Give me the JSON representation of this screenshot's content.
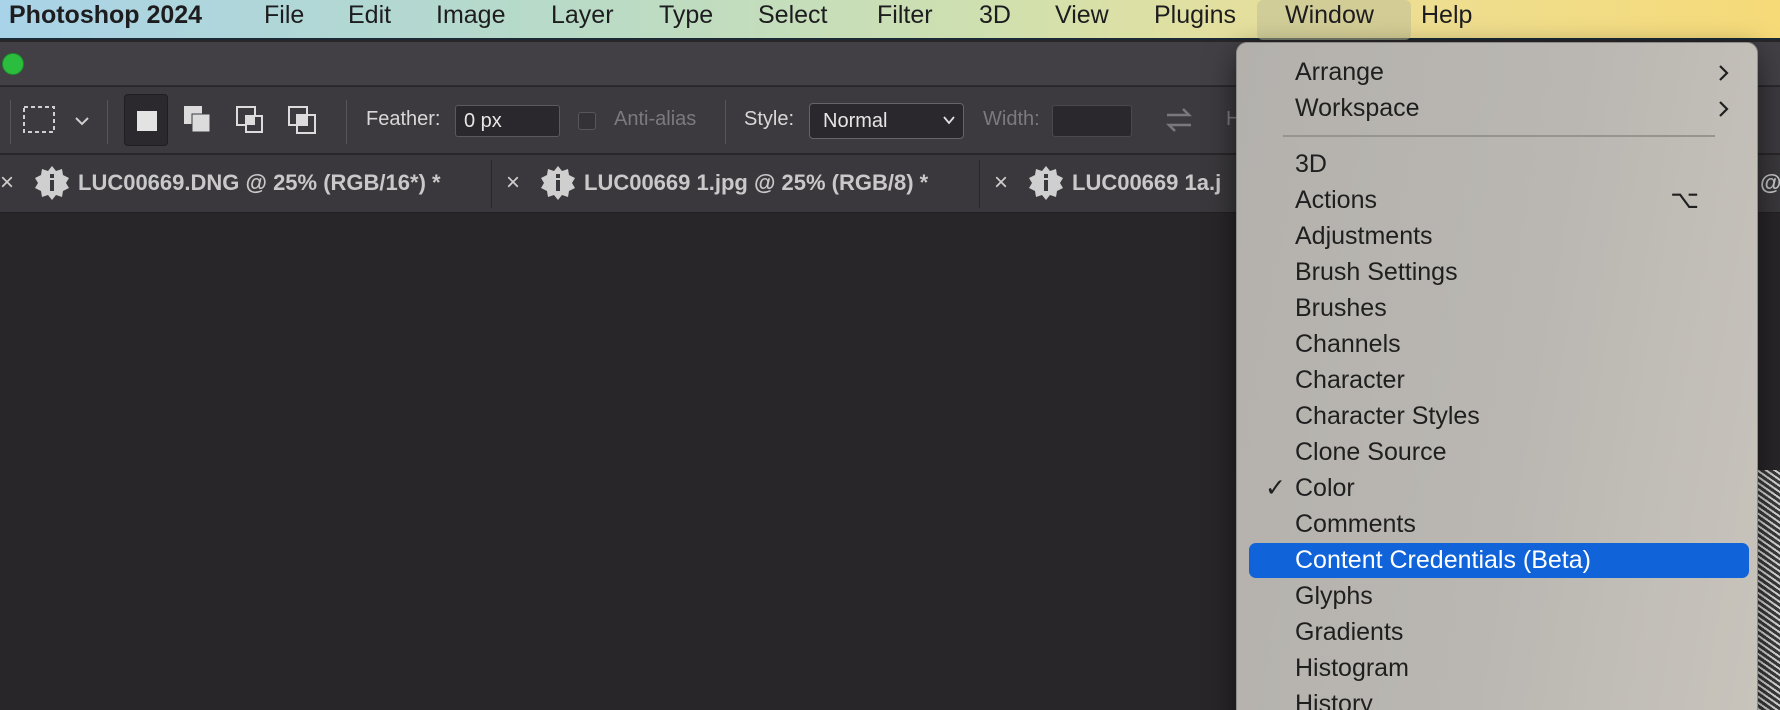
{
  "menubar": {
    "app_name": "Photoshop 2024",
    "items": [
      "File",
      "Edit",
      "Image",
      "Layer",
      "Type",
      "Select",
      "Filter",
      "3D",
      "View",
      "Plugins",
      "Window",
      "Help"
    ],
    "active": "Window"
  },
  "options_bar": {
    "feather_label": "Feather:",
    "feather_value": "0 px",
    "anti_alias_label": "Anti-alias",
    "style_label": "Style:",
    "style_value": "Normal",
    "width_label": "Width:",
    "height_label_partial": "H"
  },
  "tabs": [
    {
      "title": "LUC00669.DNG @ 25% (RGB/16*) *",
      "close": "×"
    },
    {
      "title": "LUC00669 1.jpg @ 25% (RGB/8) *",
      "close": "×"
    },
    {
      "title": "LUC00669 1a.j",
      "close": "×"
    }
  ],
  "tab_overflow_partial": "@",
  "window_menu": {
    "submenus": [
      "Arrange",
      "Workspace"
    ],
    "items": [
      {
        "label": "3D"
      },
      {
        "label": "Actions",
        "shortcut": "⌥"
      },
      {
        "label": "Adjustments"
      },
      {
        "label": "Brush Settings"
      },
      {
        "label": "Brushes"
      },
      {
        "label": "Channels"
      },
      {
        "label": "Character"
      },
      {
        "label": "Character Styles"
      },
      {
        "label": "Clone Source"
      },
      {
        "label": "Color",
        "checked": true,
        "check_mark": "✓"
      },
      {
        "label": "Comments"
      },
      {
        "label": "Content Credentials (Beta)",
        "highlighted": true
      },
      {
        "label": "Glyphs"
      },
      {
        "label": "Gradients"
      },
      {
        "label": "Histogram"
      },
      {
        "label": "History"
      }
    ]
  },
  "colors": {
    "menu_highlight": "#1063d8",
    "canvas_bg": "#282629",
    "options_bg": "#3c3a3e",
    "zoom_button": "#2bbd3e"
  }
}
